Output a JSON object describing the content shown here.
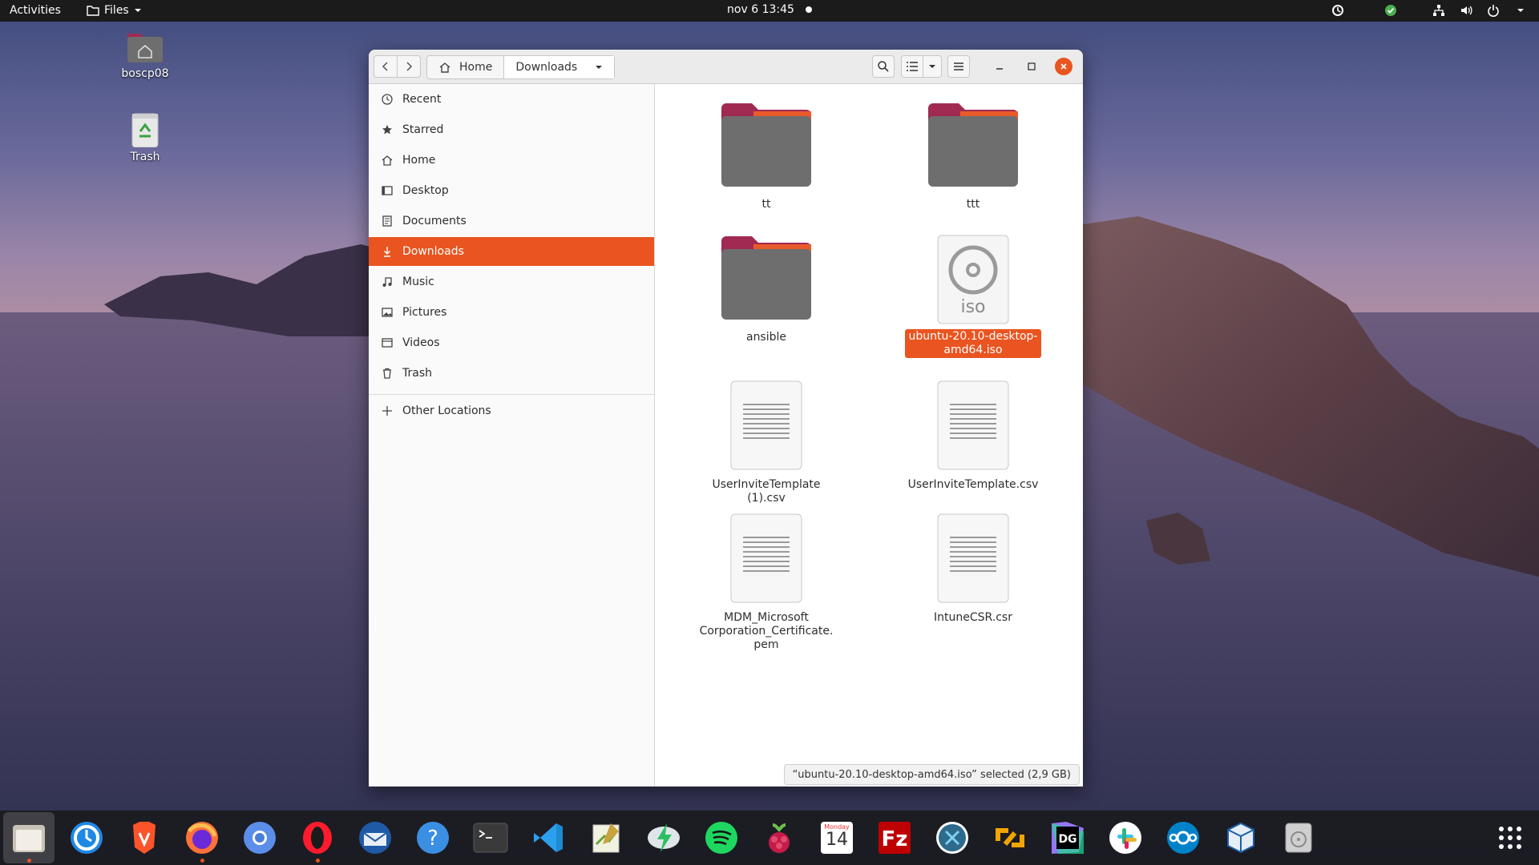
{
  "topbar": {
    "activities": "Activities",
    "app_menu": "Files",
    "clock": "nov 6  13:45"
  },
  "desktop": {
    "icons": [
      {
        "label": "boscp08",
        "icon": "home-folder-icon"
      },
      {
        "label": "Trash",
        "icon": "trash-icon"
      }
    ]
  },
  "window": {
    "pathbar": {
      "home": "Home",
      "current": "Downloads"
    },
    "sidebar": {
      "items": [
        {
          "label": "Recent",
          "icon": "clock-icon"
        },
        {
          "label": "Starred",
          "icon": "star-icon"
        },
        {
          "label": "Home",
          "icon": "home-icon"
        },
        {
          "label": "Desktop",
          "icon": "desktop-icon"
        },
        {
          "label": "Documents",
          "icon": "document-icon"
        },
        {
          "label": "Downloads",
          "icon": "download-icon",
          "selected": true
        },
        {
          "label": "Music",
          "icon": "music-icon"
        },
        {
          "label": "Pictures",
          "icon": "picture-icon"
        },
        {
          "label": "Videos",
          "icon": "video-icon"
        },
        {
          "label": "Trash",
          "icon": "trash-icon"
        }
      ],
      "other_locations": "Other Locations"
    },
    "files": [
      {
        "name": "tt",
        "type": "folder"
      },
      {
        "name": "ttt",
        "type": "folder"
      },
      {
        "name": "ansible",
        "type": "folder"
      },
      {
        "name": "ubuntu-20.10-desktop-amd64.iso",
        "type": "iso",
        "selected": true,
        "line1": "ubuntu-20.10-desktop-",
        "line2": "amd64.iso",
        "badge": "iso"
      },
      {
        "name": "UserInviteTemplate (1).csv",
        "type": "text"
      },
      {
        "name": "UserInviteTemplate.csv",
        "type": "text"
      },
      {
        "name": "MDM_Microsoft Corporation_Certificate.pem",
        "type": "text",
        "line1": "MDM_Microsoft",
        "line2": "Corporation_Certificate.",
        "line3": "pem"
      },
      {
        "name": "IntuneCSR.csr",
        "type": "text"
      }
    ],
    "status": "“ubuntu-20.10-desktop-amd64.iso” selected  (2,9 GB)"
  },
  "dock": {
    "items": [
      "files-icon",
      "timeshift-icon",
      "brave-icon",
      "firefox-icon",
      "chromium-icon",
      "opera-icon",
      "thunderbird-icon",
      "help-icon",
      "terminal-icon",
      "vscode-icon",
      "gedit-icon",
      "deluge-icon",
      "spotify-icon",
      "raspberry-pi-icon",
      "calendar-icon",
      "filezilla-icon",
      "remmina-icon",
      "sync-icon",
      "datagrip-icon",
      "slack-icon",
      "nextcloud-icon",
      "virtualbox-icon",
      "disks-icon"
    ],
    "calendar_day": "Monday",
    "calendar_date": "14"
  },
  "colors": {
    "accent": "#e95420",
    "folder": "#6e6e6e",
    "folder_tab": "#a02a52"
  }
}
